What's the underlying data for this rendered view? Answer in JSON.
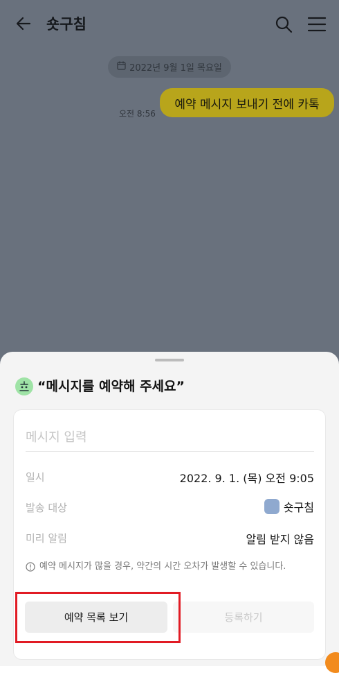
{
  "header": {
    "title": "숏구침"
  },
  "chat": {
    "date_label": "2022년 9월 1일 목요일",
    "message": "예약 메시지 보내기 전에 카톡",
    "time": "오전 8:56"
  },
  "sheet": {
    "title": "“메시지를 예약해 주세요”",
    "input_placeholder": "메시지 입력",
    "rows": [
      {
        "label": "일시",
        "value": "2022. 9. 1. (목) 오전 9:05"
      },
      {
        "label": "발송 대상",
        "value": "숏구침"
      },
      {
        "label": "미리 알림",
        "value": "알림 받지 않음"
      }
    ],
    "notice": "예약 메시지가 많을 경우, 약간의 시간 오차가 발생할 수 있습니다.",
    "buttons": {
      "view_list": "예약 목록 보기",
      "register": "등록하기"
    }
  },
  "colors": {
    "bubble": "#b8a51b",
    "overlay": "#69717d",
    "highlight": "#e11b24"
  },
  "icons": [
    "back-arrow-icon",
    "search-icon",
    "menu-icon",
    "calendar-icon",
    "reservation-icon",
    "info-icon"
  ]
}
